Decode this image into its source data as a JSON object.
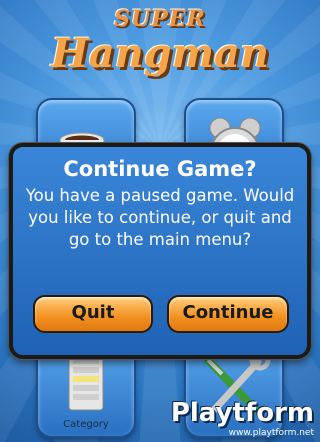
{
  "logo": {
    "line1": "SUPER",
    "line2": "Hangman"
  },
  "tiles": {
    "top_left_icon": "coffee-cup-icon",
    "top_right_icon": "alarm-clock-icon",
    "bottom_left_icon": "category-list-icon",
    "bottom_left_label": "Category",
    "bottom_right_icon": "wrench-screwdriver-icon"
  },
  "dialog": {
    "title": "Continue Game?",
    "body": "You have a paused game. Would you like to continue, or quit and go to the main menu?",
    "quit_label": "Quit",
    "continue_label": "Continue"
  },
  "watermark": {
    "brand": "Playtform",
    "url": "www.playtform.net"
  }
}
